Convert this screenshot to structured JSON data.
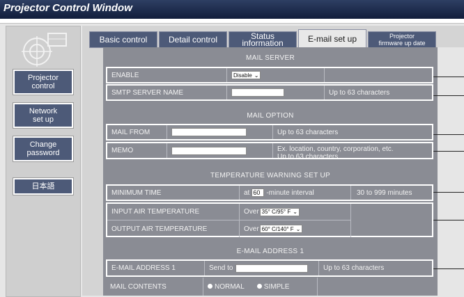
{
  "window_title": "Projector Control Window",
  "sidebar": {
    "buttons": [
      "Projector\ncontrol",
      "Network\nset up",
      "Change\npassword",
      "日本語"
    ]
  },
  "tabs": [
    {
      "label": "Basic control"
    },
    {
      "label": "Detail control"
    },
    {
      "label": "Status information"
    },
    {
      "label": "E-mail set up",
      "active": true
    },
    {
      "label": "Projector\nfirmware up date"
    }
  ],
  "mail_server": {
    "title": "MAIL SERVER",
    "enable_label": "ENABLE",
    "enable_value": "Disable",
    "smtp_label": "SMTP SERVER NAME",
    "smtp_value": "",
    "smtp_hint": "Up to 63 characters"
  },
  "mail_option": {
    "title": "MAIL OPTION",
    "from_label": "MAIL FROM",
    "from_hint": "Up to 63 characters",
    "memo_label": "MEMO",
    "memo_hint_1": "Ex. location, country, corporation, etc.",
    "memo_hint_2": "Up to 63 characters"
  },
  "temperature": {
    "title": "TEMPERATURE WARNING SET UP",
    "min_time_label": "MINIMUM TIME",
    "min_time_prefix": "at",
    "min_time_value": "60",
    "min_time_suffix": "-minute interval",
    "min_time_range": "30 to 999 minutes",
    "input_label": "INPUT AIR TEMPERATURE",
    "input_prefix": "Over",
    "input_value": "35° C/95° F",
    "output_label": "OUTPUT AIR TEMPERATURE",
    "output_prefix": "Over",
    "output_value": "60° C/140° F"
  },
  "email1": {
    "title": "E-MAIL ADDRESS 1",
    "address_label": "E-MAIL ADDRESS 1",
    "send_to": "Send to",
    "hint": "Up to 63 characters",
    "contents_label": "MAIL CONTENTS",
    "opt_normal": "NORMAL",
    "opt_simple": "SIMPLE"
  }
}
